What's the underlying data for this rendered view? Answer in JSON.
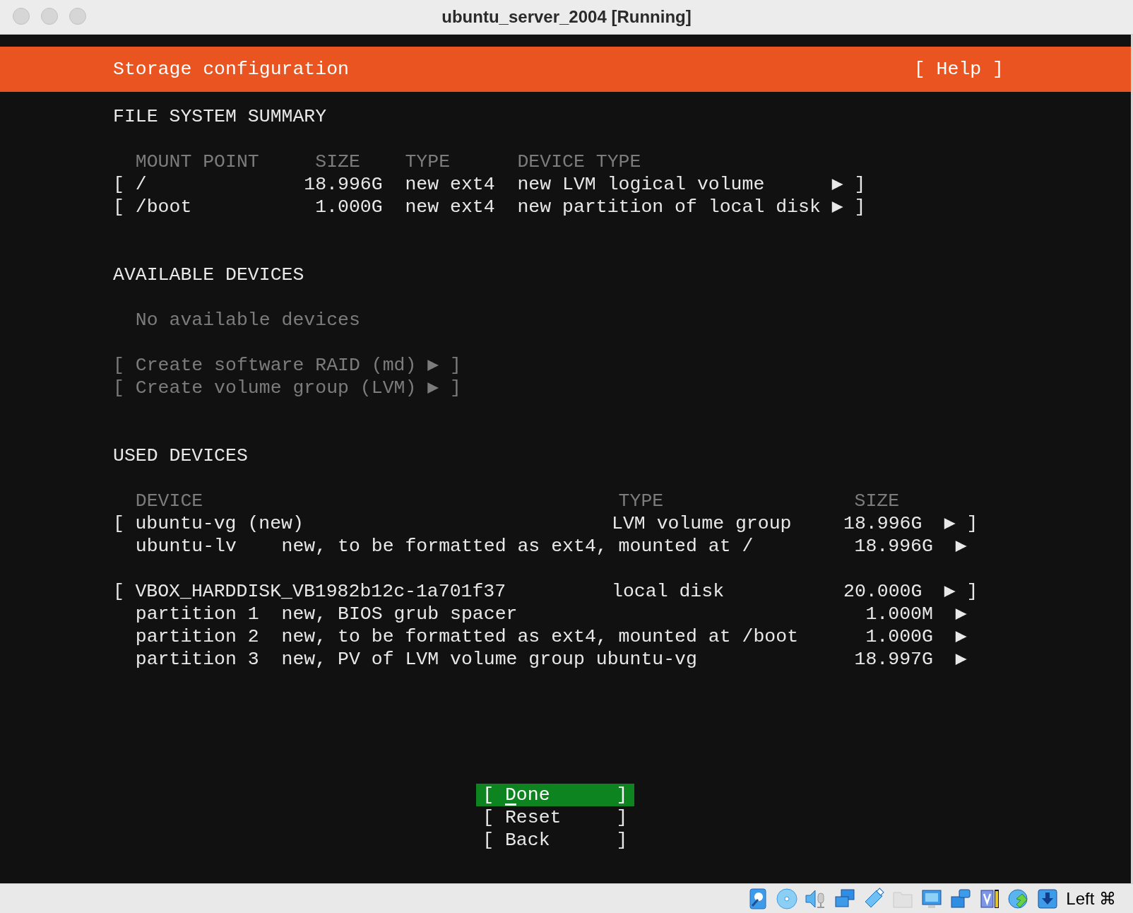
{
  "window": {
    "title": "ubuntu_server_2004 [Running]"
  },
  "header": {
    "title": "Storage configuration",
    "help": "[ Help ]"
  },
  "file_system_summary": {
    "heading": "FILE SYSTEM SUMMARY",
    "columns": [
      "MOUNT POINT",
      "SIZE",
      "TYPE",
      "DEVICE TYPE"
    ],
    "rows": [
      {
        "open": "[",
        "mount_point": "/",
        "size": "18.996G",
        "type": "new ext4",
        "device_type": "new LVM logical volume",
        "close": "▶ ]"
      },
      {
        "open": "[",
        "mount_point": "/boot",
        "size": "1.000G",
        "type": "new ext4",
        "device_type": "new partition of local disk",
        "close": "▶ ]"
      }
    ]
  },
  "available_devices": {
    "heading": "AVAILABLE DEVICES",
    "empty_message": "No available devices",
    "actions": [
      {
        "open": "[",
        "label": "Create software RAID (md)",
        "close": "▶ ]",
        "disabled": true
      },
      {
        "open": "[",
        "label": "Create volume group (LVM)",
        "close": "▶ ]",
        "disabled": true
      }
    ]
  },
  "used_devices": {
    "heading": "USED DEVICES",
    "columns": [
      "DEVICE",
      "TYPE",
      "SIZE"
    ],
    "groups": [
      {
        "open": "[",
        "device": "ubuntu-vg (new)",
        "type": "LVM volume group",
        "size": "18.996G",
        "close": "▶ ]",
        "children": [
          {
            "name": "ubuntu-lv",
            "description": "new, to be formatted as ext4, mounted at /",
            "size": "18.996G",
            "arrow": "▶"
          }
        ]
      },
      {
        "open": "[",
        "device": "VBOX_HARDDISK_VB1982b12c-1a701f37",
        "type": "local disk",
        "size": "20.000G",
        "close": "▶ ]",
        "children": [
          {
            "name": "partition 1",
            "description": "new, BIOS grub spacer",
            "size": "1.000M",
            "arrow": "▶"
          },
          {
            "name": "partition 2",
            "description": "new, to be formatted as ext4, mounted at /boot",
            "size": "1.000G",
            "arrow": "▶"
          },
          {
            "name": "partition 3",
            "description": "new, PV of LVM volume group ubuntu-vg",
            "size": "18.997G",
            "arrow": "▶"
          }
        ]
      }
    ]
  },
  "buttons": [
    {
      "open": "[",
      "label": "Done",
      "close": "]",
      "selected": true
    },
    {
      "open": "[",
      "label": "Reset",
      "close": "]",
      "selected": false
    },
    {
      "open": "[",
      "label": "Back",
      "close": "]",
      "selected": false
    }
  ],
  "status_bar": {
    "host_key": "Left ⌘"
  }
}
